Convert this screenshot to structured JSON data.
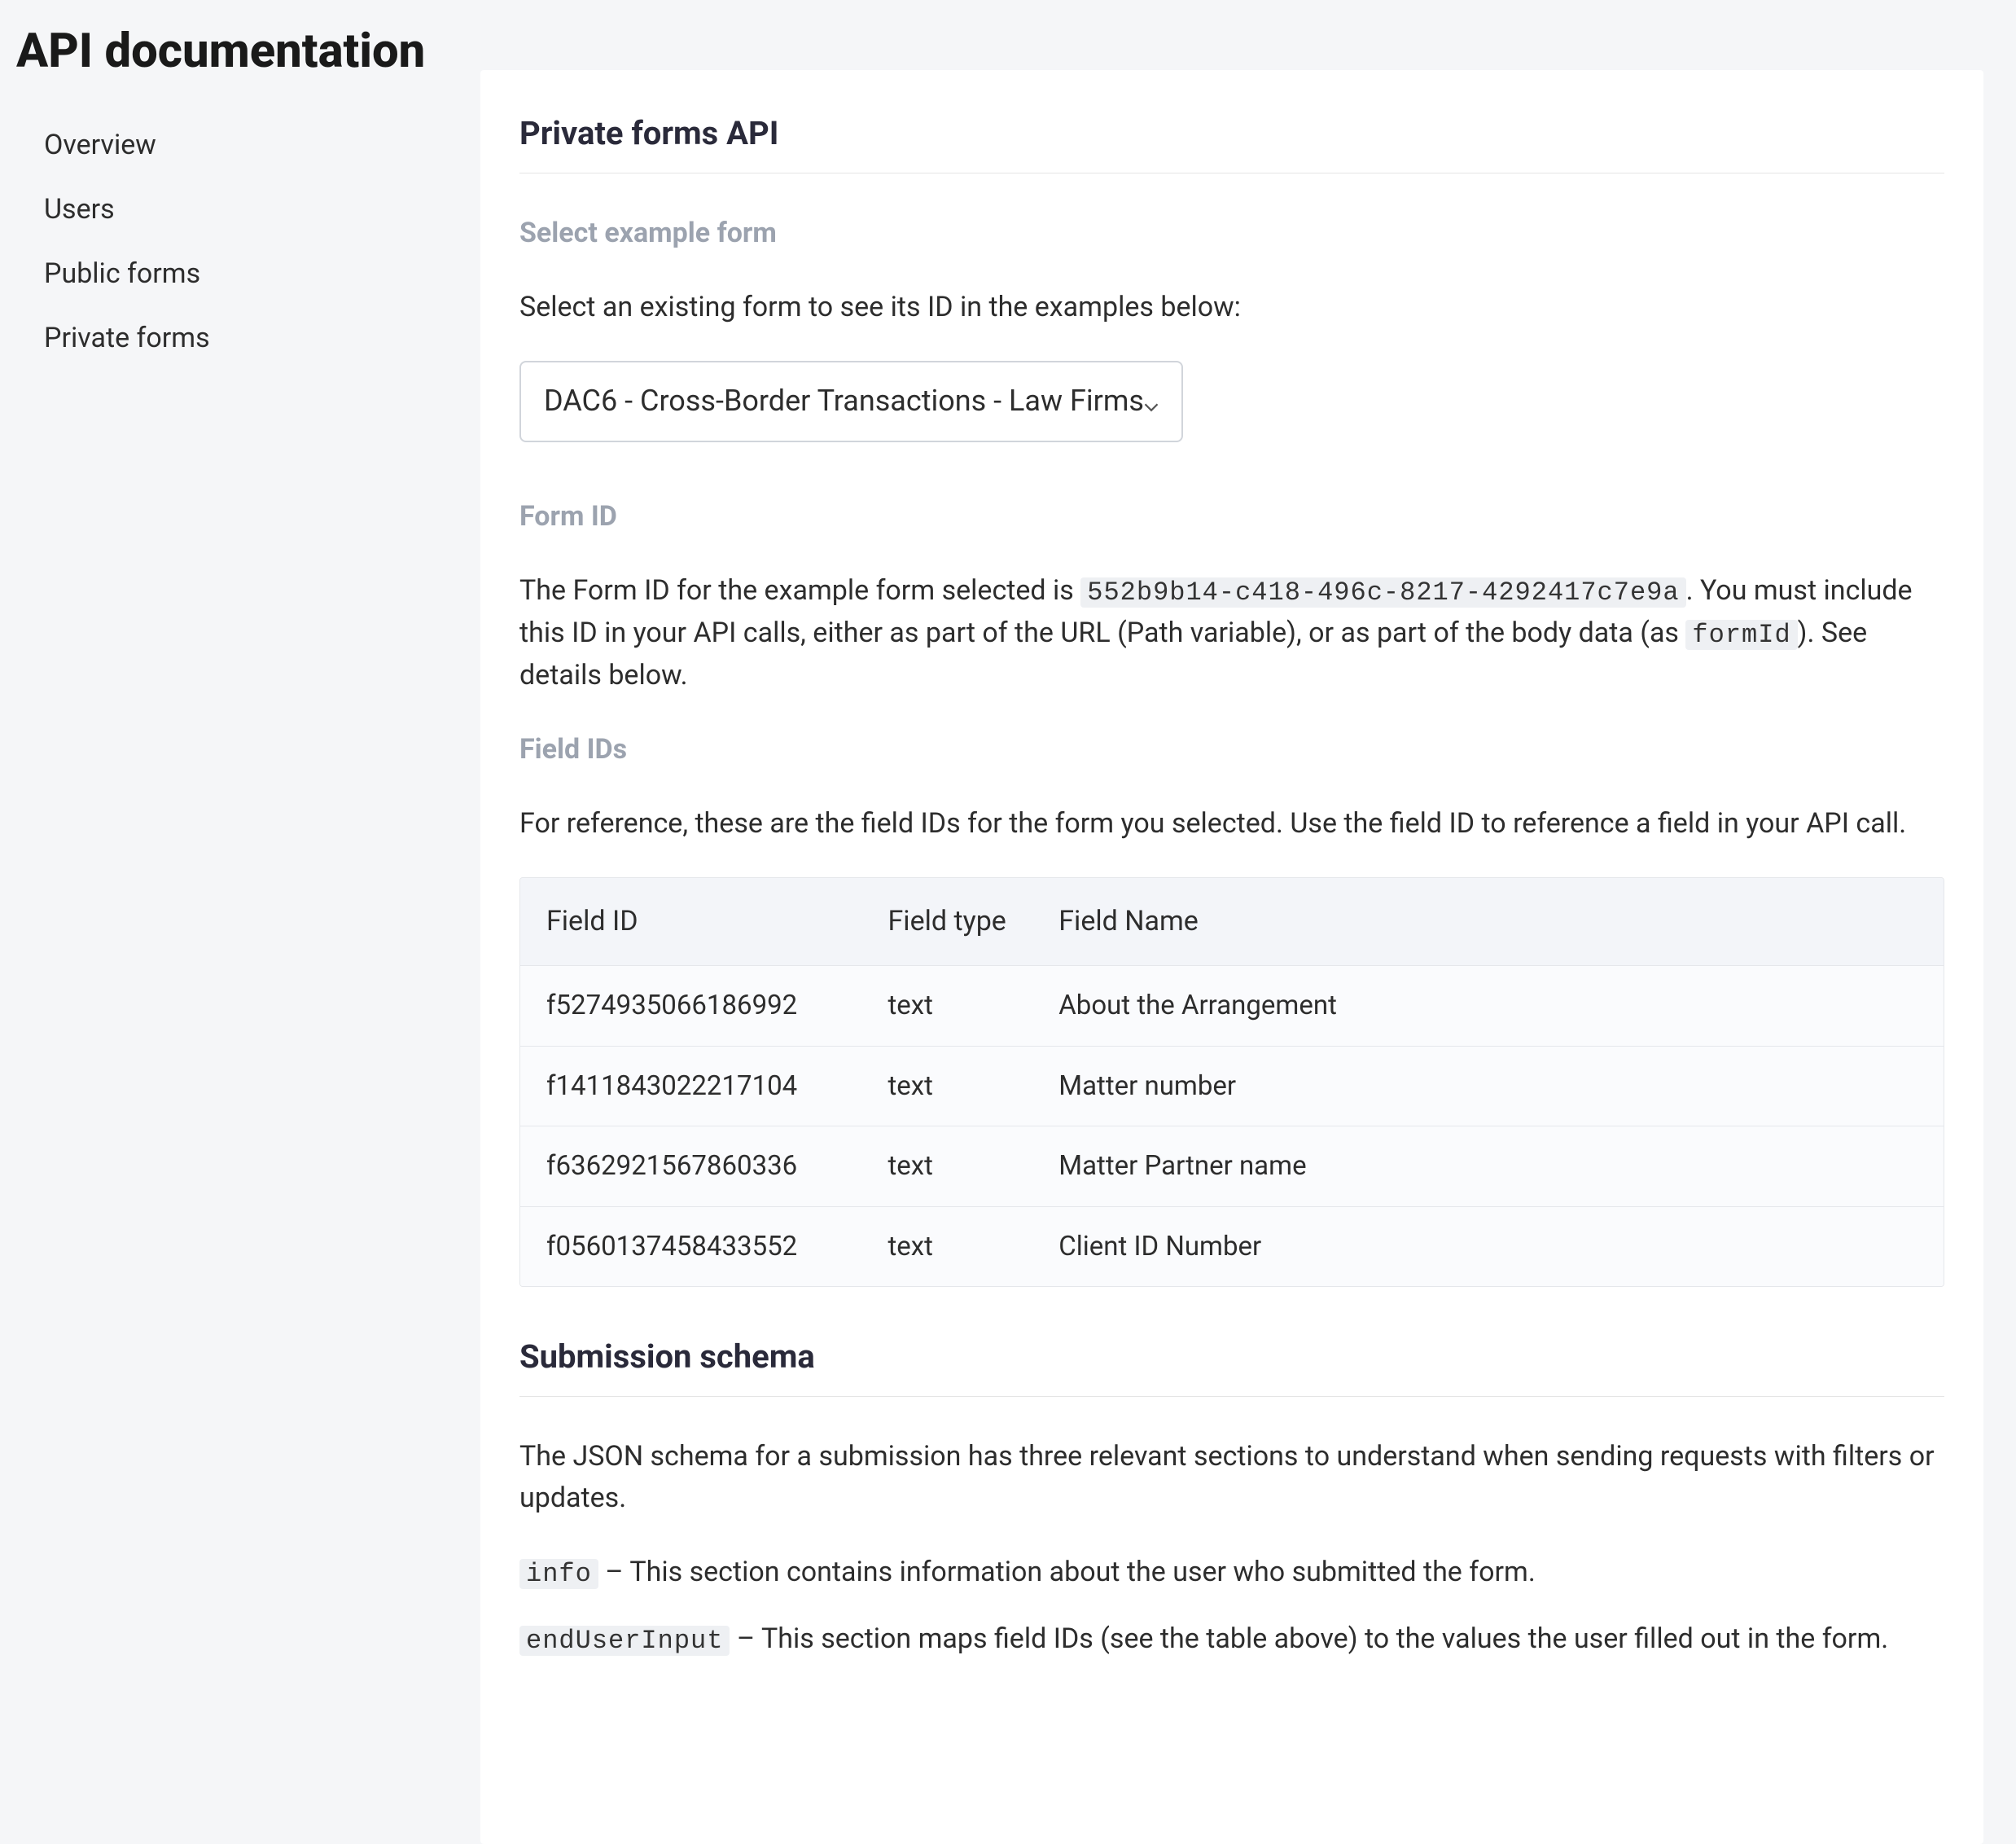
{
  "header": {
    "title": "API documentation"
  },
  "sidebar": {
    "items": [
      {
        "label": "Overview"
      },
      {
        "label": "Users"
      },
      {
        "label": "Public forms"
      },
      {
        "label": "Private forms"
      }
    ]
  },
  "main": {
    "section_title": "Private forms API",
    "select_form": {
      "heading": "Select example form",
      "instruction": "Select an existing form to see its ID in the examples below:",
      "selected_option": "DAC6 - Cross-Border Transactions - Law Firms"
    },
    "form_id": {
      "heading": "Form ID",
      "text_before": "The Form ID for the example form selected is ",
      "code_value": "552b9b14-c418-496c-8217-4292417c7e9a",
      "text_mid": ". You must include this ID in your API calls, either as part of the URL (Path variable), or as part of the body data (as ",
      "code_formid": "formId",
      "text_after": "). See details below."
    },
    "field_ids": {
      "heading": "Field IDs",
      "instruction": "For reference, these are the field IDs for the form you selected. Use the field ID to reference a field in your API call.",
      "columns": {
        "col1": "Field ID",
        "col2": "Field type",
        "col3": "Field Name"
      },
      "rows": [
        {
          "id": "f5274935066186992",
          "type": "text",
          "name": "About the Arrangement"
        },
        {
          "id": "f1411843022217104",
          "type": "text",
          "name": "Matter number"
        },
        {
          "id": "f6362921567860336",
          "type": "text",
          "name": "Matter Partner name"
        },
        {
          "id": "f0560137458433552",
          "type": "text",
          "name": "Client ID Number"
        }
      ]
    },
    "submission_schema": {
      "heading": "Submission schema",
      "intro": "The JSON schema for a submission has three relevant sections to understand when sending requests with filters or updates.",
      "items": [
        {
          "code": "info",
          "desc": " – This section contains information about the user who submitted the form."
        },
        {
          "code": "endUserInput",
          "desc": " – This section maps field IDs (see the table above) to the values the user filled out in the form."
        }
      ]
    }
  }
}
